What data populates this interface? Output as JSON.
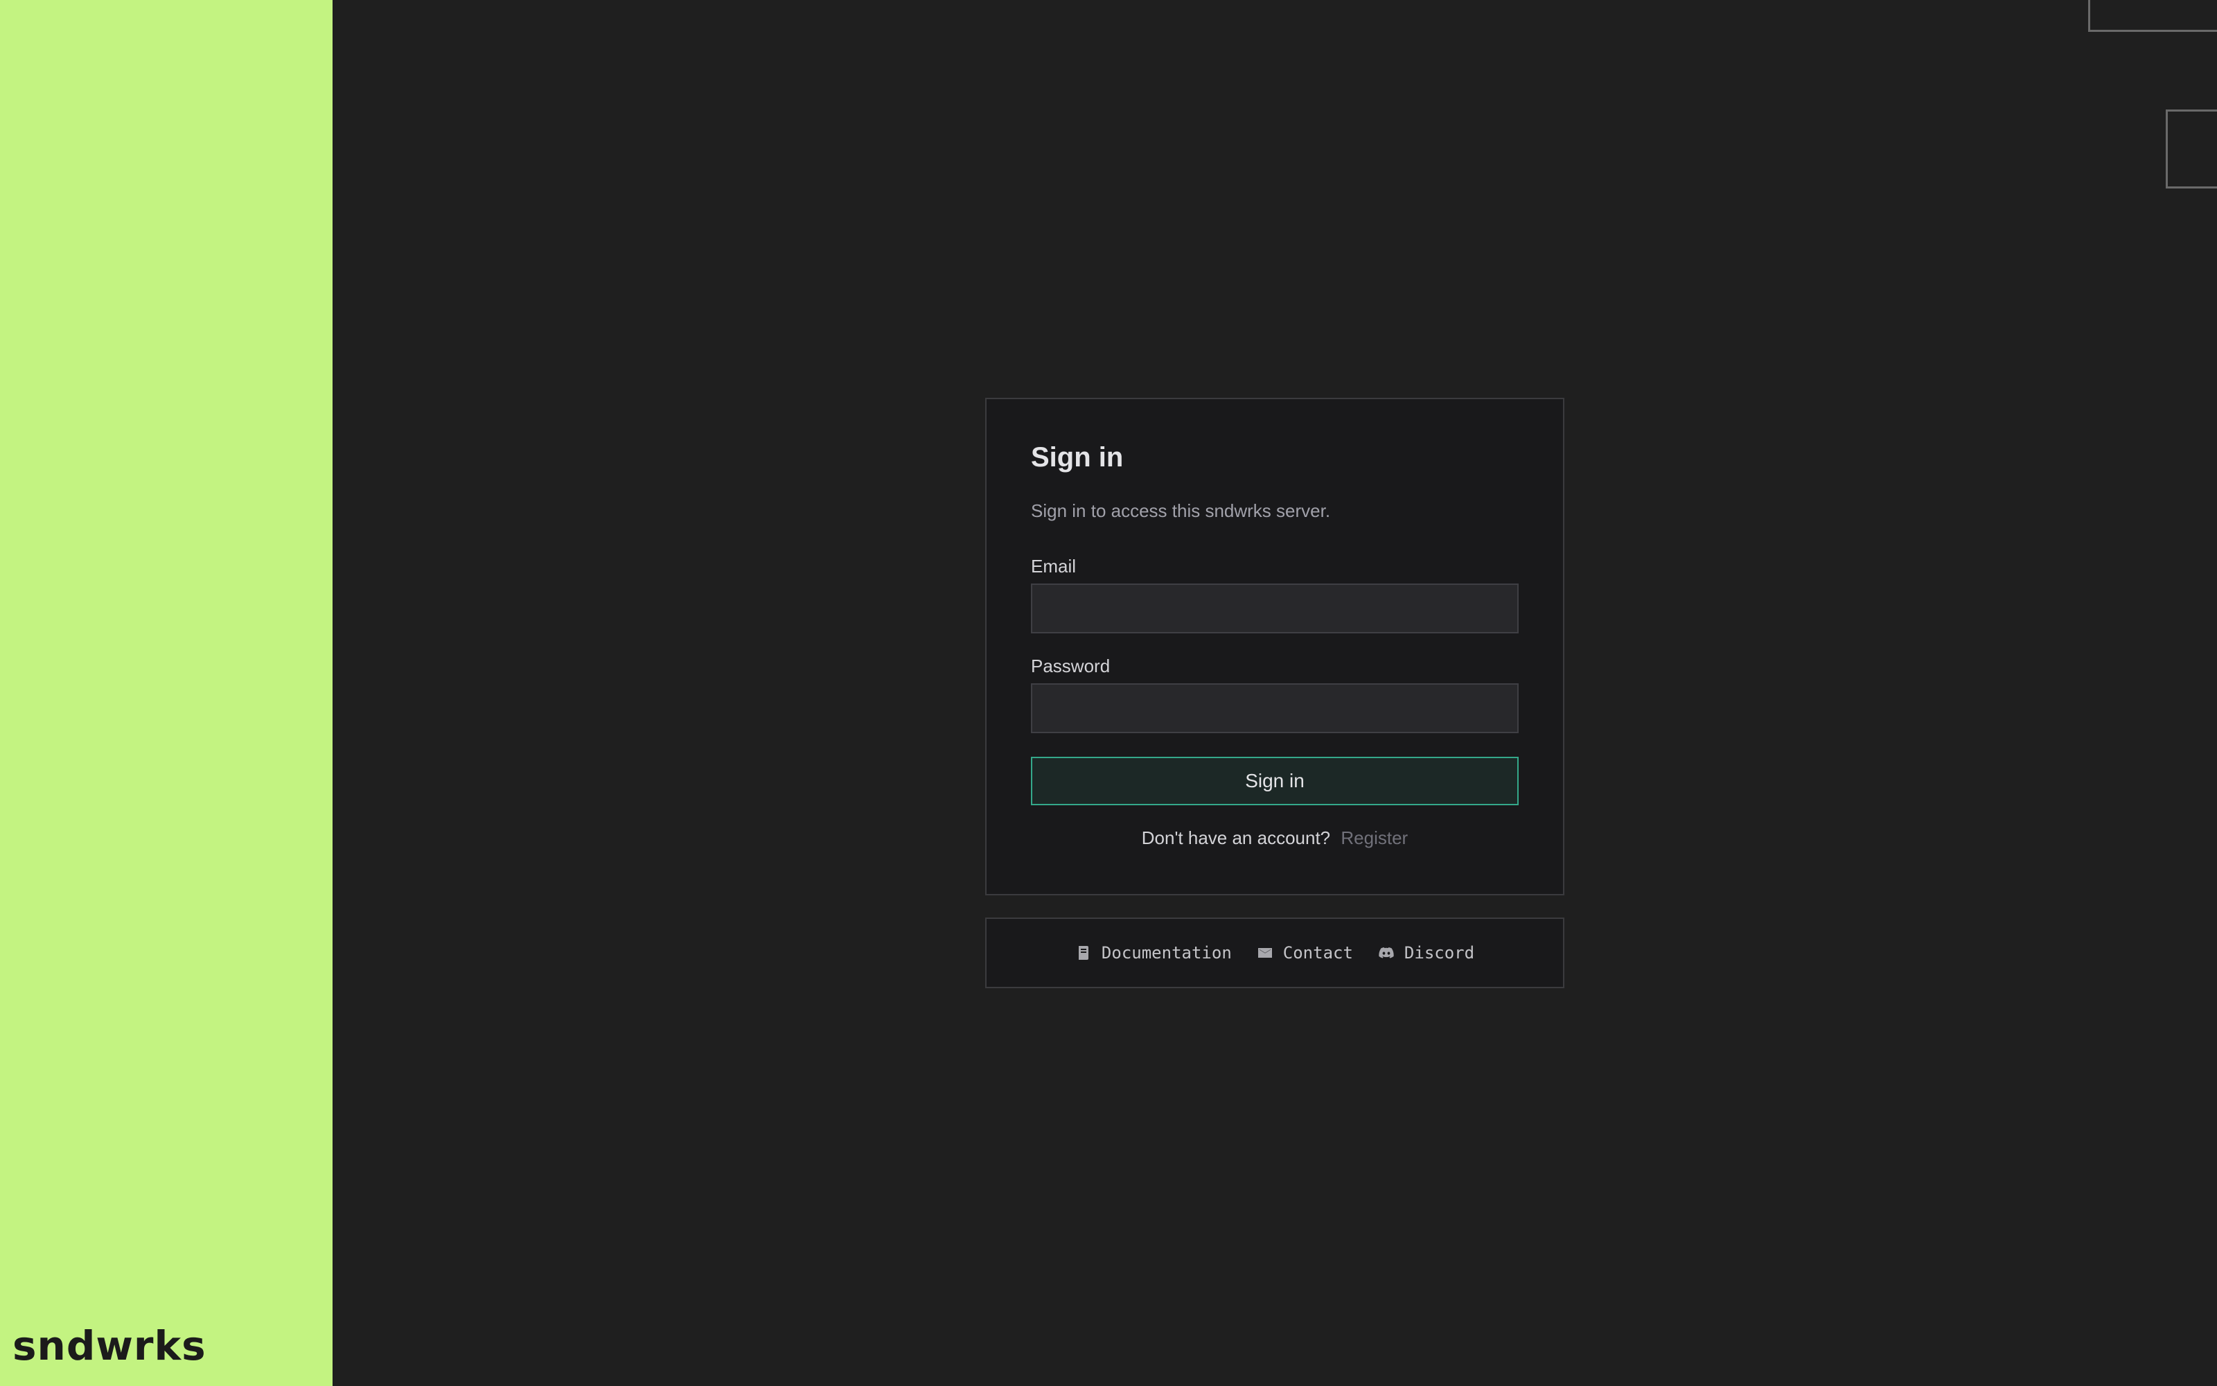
{
  "brand": {
    "name": "sndwrks"
  },
  "signin": {
    "title": "Sign in",
    "subtitle": "Sign in to access this sndwrks server.",
    "email_label": "Email",
    "email_value": "",
    "password_label": "Password",
    "password_value": "",
    "submit_label": "Sign in",
    "register_prompt": "Don't have an account?",
    "register_link": "Register"
  },
  "footer": {
    "links": [
      {
        "label": "Documentation",
        "icon": "book-icon"
      },
      {
        "label": "Contact",
        "icon": "envelope-icon"
      },
      {
        "label": "Discord",
        "icon": "discord-icon"
      }
    ]
  },
  "colors": {
    "accent_panel": "#c3f381",
    "button_border": "#34a88a",
    "background": "#1f1f1f"
  }
}
